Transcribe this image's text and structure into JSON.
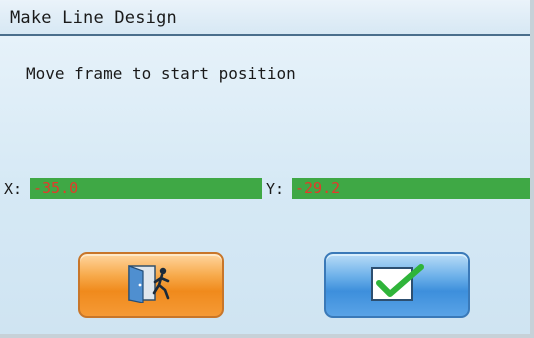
{
  "dialog": {
    "title": "Make Line Design",
    "message": "Move frame to start position"
  },
  "coordinates": {
    "x_label": "X:",
    "x_value": "-35.0",
    "y_label": "Y:",
    "y_value": "-29.2"
  },
  "buttons": {
    "exit_icon": "exit-door-icon",
    "confirm_icon": "checkmark-icon"
  },
  "colors": {
    "field_background": "#3fa845",
    "field_text": "#e43a2a",
    "exit_button": "#f08a1c",
    "confirm_button": "#3d8fdc",
    "checkmark": "#2fb43a"
  }
}
